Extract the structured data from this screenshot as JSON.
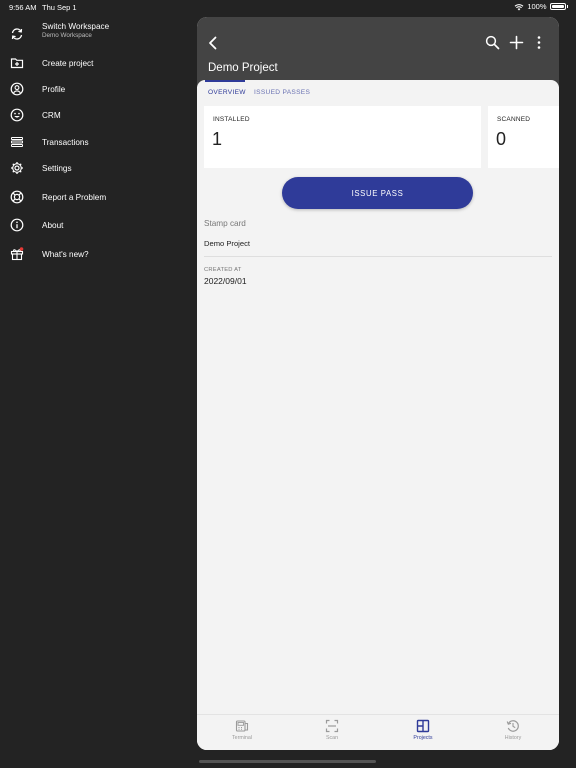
{
  "status_bar": {
    "time": "9:56 AM",
    "date": "Thu Sep 1",
    "battery": "100%"
  },
  "sidebar": {
    "workspace": {
      "title": "Switch Workspace",
      "subtitle": "Demo Workspace",
      "icon": "sync-icon"
    },
    "items": [
      {
        "label": "Create project",
        "icon": "folder-plus-icon"
      },
      {
        "label": "Profile",
        "icon": "user-circle-icon"
      },
      {
        "label": "CRM",
        "icon": "smiley-icon"
      },
      {
        "label": "Transactions",
        "icon": "list-icon"
      },
      {
        "label": "Settings",
        "icon": "gear-icon"
      },
      {
        "label": "Report a Problem",
        "icon": "lifebuoy-icon"
      },
      {
        "label": "About",
        "icon": "info-icon"
      },
      {
        "label": "What's new?",
        "icon": "gift-icon"
      }
    ]
  },
  "header": {
    "title": "Demo Project"
  },
  "tabs": [
    {
      "label": "OVERVIEW",
      "active": true
    },
    {
      "label": "ISSUED PASSES",
      "active": false
    }
  ],
  "stats": [
    {
      "label": "INSTALLED",
      "value": "1"
    },
    {
      "label": "SCANNED",
      "value": "0"
    }
  ],
  "actions": {
    "issue_pass": "ISSUE PASS"
  },
  "details": {
    "type": "Stamp card",
    "project_name": "Demo Project",
    "created_label": "CREATED AT",
    "created_value": "2022/09/01"
  },
  "bottom_nav": [
    {
      "label": "Terminal",
      "icon": "terminal-icon",
      "active": false
    },
    {
      "label": "Scan",
      "icon": "scan-icon",
      "active": false
    },
    {
      "label": "Projects",
      "icon": "projects-icon",
      "active": true
    },
    {
      "label": "History",
      "icon": "history-icon",
      "active": false
    }
  ],
  "colors": {
    "accent": "#2f3b99",
    "sidebar_bg": "#232323",
    "appbar_bg": "#444444",
    "content_bg": "#f3f3f3",
    "badge": "#e53935"
  }
}
